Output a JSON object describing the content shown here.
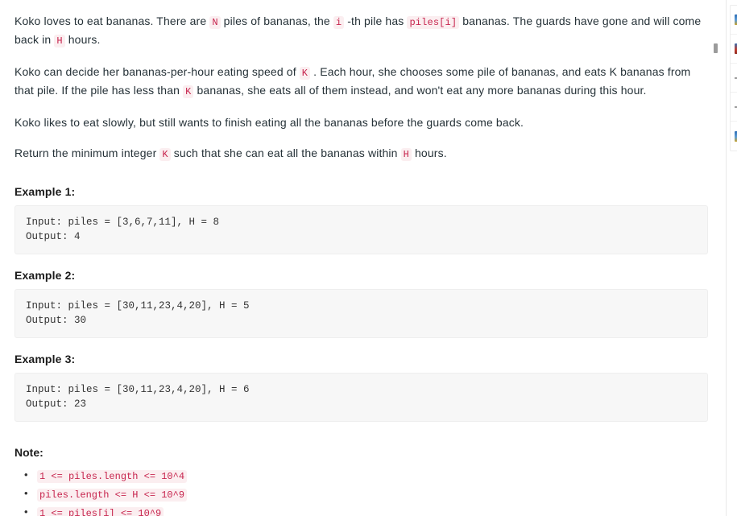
{
  "document": {
    "paragraphs": [
      {
        "id": "p1",
        "segments": [
          {
            "type": "text",
            "value": "Koko loves to eat bananas.  There are "
          },
          {
            "type": "code",
            "value": "N"
          },
          {
            "type": "text",
            "value": " piles of bananas, the "
          },
          {
            "type": "code",
            "value": "i"
          },
          {
            "type": "text",
            "value": " -th pile has "
          },
          {
            "type": "code",
            "value": "piles[i]"
          },
          {
            "type": "text",
            "value": " bananas.  The guards have gone and will come back in "
          },
          {
            "type": "code",
            "value": "H"
          },
          {
            "type": "text",
            "value": " hours."
          }
        ]
      },
      {
        "id": "p2",
        "segments": [
          {
            "type": "text",
            "value": "Koko can decide her bananas-per-hour eating speed of "
          },
          {
            "type": "code",
            "value": "K"
          },
          {
            "type": "text",
            "value": " .  Each hour, she chooses some pile of bananas, and eats K bananas from that pile.  If the pile has less than "
          },
          {
            "type": "code",
            "value": "K"
          },
          {
            "type": "text",
            "value": " bananas, she eats all of them instead, and won't eat any more bananas during this hour."
          }
        ]
      },
      {
        "id": "p3",
        "segments": [
          {
            "type": "text",
            "value": "Koko likes to eat slowly, but still wants to finish eating all the bananas before the guards come back."
          }
        ]
      },
      {
        "id": "p4",
        "segments": [
          {
            "type": "text",
            "value": "Return the minimum integer "
          },
          {
            "type": "code",
            "value": "K"
          },
          {
            "type": "text",
            "value": " such that she can eat all the bananas within "
          },
          {
            "type": "code",
            "value": "H"
          },
          {
            "type": "text",
            "value": " hours."
          }
        ]
      }
    ],
    "examples": [
      {
        "title": "Example 1:",
        "input_line": "Input: piles = [3,6,7,11], H = 8",
        "output_line": "Output: 4"
      },
      {
        "title": "Example 2:",
        "input_line": "Input: piles = [30,11,23,4,20], H = 5",
        "output_line": "Output: 30"
      },
      {
        "title": "Example 3:",
        "input_line": "Input: piles = [30,11,23,4,20], H = 6",
        "output_line": "Output: 23"
      }
    ],
    "note": {
      "title": "Note:",
      "items": [
        "1 <= piles.length <= 10^4",
        "piles.length <= H <= 10^9",
        "1 <= piles[i] <= 10^9"
      ]
    }
  },
  "side_panel": {
    "rows": [
      {
        "icon": "file-blue-icon",
        "icon_kind": "blue",
        "label": ""
      },
      {
        "icon": "file-red-icon",
        "icon_kind": "red",
        "label": ""
      },
      {
        "icon": "dash-icon",
        "icon_kind": "dash",
        "label": ""
      },
      {
        "icon": "dash-icon",
        "icon_kind": "dash",
        "label": ""
      },
      {
        "icon": "file-blue-icon",
        "icon_kind": "blue",
        "label": ""
      }
    ]
  },
  "colors": {
    "inline_code_text": "#c7254e",
    "inline_code_bg": "#fbeef0",
    "code_block_bg": "#f7f7f7",
    "body_text": "#263238",
    "heading_text": "#1c1c1c"
  }
}
